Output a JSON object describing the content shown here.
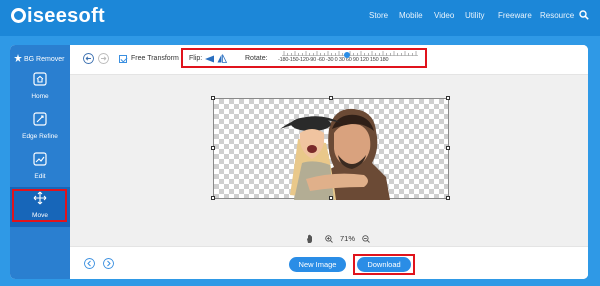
{
  "site": {
    "logo_text": "aiseesoft",
    "nav": [
      "Store",
      "Mobile",
      "Video",
      "Utility",
      "Freeware",
      "Resource"
    ]
  },
  "sidebar": {
    "title": "BG Remover",
    "items": [
      {
        "label": "Home",
        "icon": "home-icon"
      },
      {
        "label": "Edge Refine",
        "icon": "edge-refine-icon"
      },
      {
        "label": "Edit",
        "icon": "edit-image-icon"
      },
      {
        "label": "Move",
        "icon": "move-icon",
        "active": true
      }
    ]
  },
  "toolbar": {
    "free_transform_label": "Free Transform",
    "free_transform_checked": true,
    "flip_label": "Flip:",
    "rotate_label": "Rotate:",
    "rotate_ticks": "-180-150-120-90 -60 -30  0  30  60  90 120 150 180",
    "rotate_value": 0
  },
  "canvas": {
    "zoom": "71%",
    "subject": "Photo of a smiling couple with background removed (transparent checkerboard)"
  },
  "bottom": {
    "new_image_label": "New Image",
    "download_label": "Download"
  },
  "colors": {
    "brand_blue": "#1c87d8",
    "sidebar_blue": "#2a7fd0",
    "active_blue": "#1766b9",
    "button_blue": "#2a8de6",
    "highlight_red": "#e0131c"
  }
}
